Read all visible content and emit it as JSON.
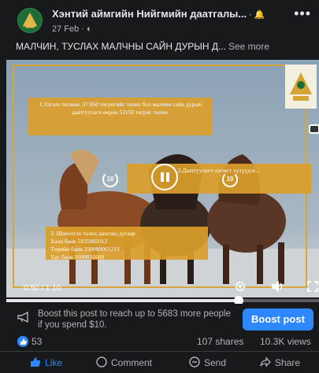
{
  "post": {
    "page_name": "Хэнтий аймгийн Нийгмийн даатгалы...",
    "bell_glyph": "· 🔔",
    "more_glyph": "•••",
    "date": "27 Feb · ",
    "audience_icon": "globe-icon",
    "text": "МАЛЧИН, ТУСЛАХ МАЛЧНЫ САЙН ДУРЫН Д...",
    "see_more": "See more"
  },
  "video": {
    "captions": [
      "1.Улсын төсвөөс 37.950 төгрөгийг төлөх бол малчин сайн дурын даатгуулагч өөрөө 51150 төгрөг төлнө.",
      "2.Давуулагч нэгжгт хүзүүдэх болдог (2) мал болон эсрэгүүрээс авсан нөхцөл ... ",
      "3. Шинэтгэх төлөх дансны дугаар\nХаан банк 5935002012\nТөрийн банк 250000061233\nХас банк 5000031689"
    ],
    "caption_mid": "2.Даатгуулагч нэгжгт хүзүүдэх...",
    "skip_back_label": "10",
    "skip_forward_label": "10",
    "time": "0:50 / 1:10",
    "progress_fraction": 0.74
  },
  "boost": {
    "text": "Boost this post to reach up to 5683 more people if you spend $10.",
    "button_label": "Boost post"
  },
  "stats": {
    "likes": "53",
    "shares": "107 shares",
    "views": "10.3K views"
  },
  "actions": {
    "like": "Like",
    "comment": "Comment",
    "send": "Send",
    "share": "Share"
  },
  "colors": {
    "accent": "#2d88ff",
    "caption_bg": "#db9e2b",
    "background": "#18191a"
  }
}
